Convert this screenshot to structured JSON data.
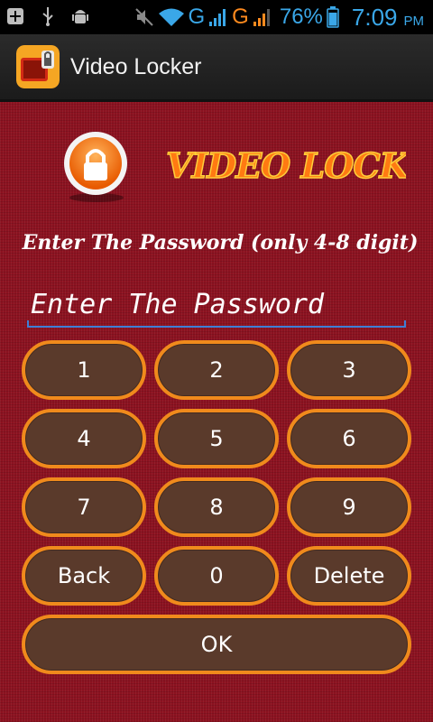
{
  "status_bar": {
    "icons": [
      "add-icon",
      "usb-icon",
      "android-debug-icon",
      "mute-icon",
      "wifi-icon",
      "signal-icon"
    ],
    "network_1": "G",
    "network_2": "G",
    "battery_percent": "76%",
    "time": "7:09",
    "ampm": "PM"
  },
  "app_bar": {
    "title": "Video Locker",
    "icon": "video-locker-app-icon"
  },
  "main": {
    "logo_text": "VIDEO LOCK",
    "prompt": "Enter The Password (only 4-8 digit)",
    "password_field": {
      "placeholder": "Enter The Password",
      "value": ""
    },
    "keypad": {
      "rows": [
        [
          "1",
          "2",
          "3"
        ],
        [
          "4",
          "5",
          "6"
        ],
        [
          "7",
          "8",
          "9"
        ],
        [
          "Back",
          "0",
          "Delete"
        ]
      ],
      "ok_label": "OK"
    }
  },
  "colors": {
    "background": "#8c1220",
    "button_fill": "#5a3a2b",
    "button_border": "#f08a1c",
    "logo_orange": "#ff7a12",
    "status_blue": "#3aa7e8"
  }
}
